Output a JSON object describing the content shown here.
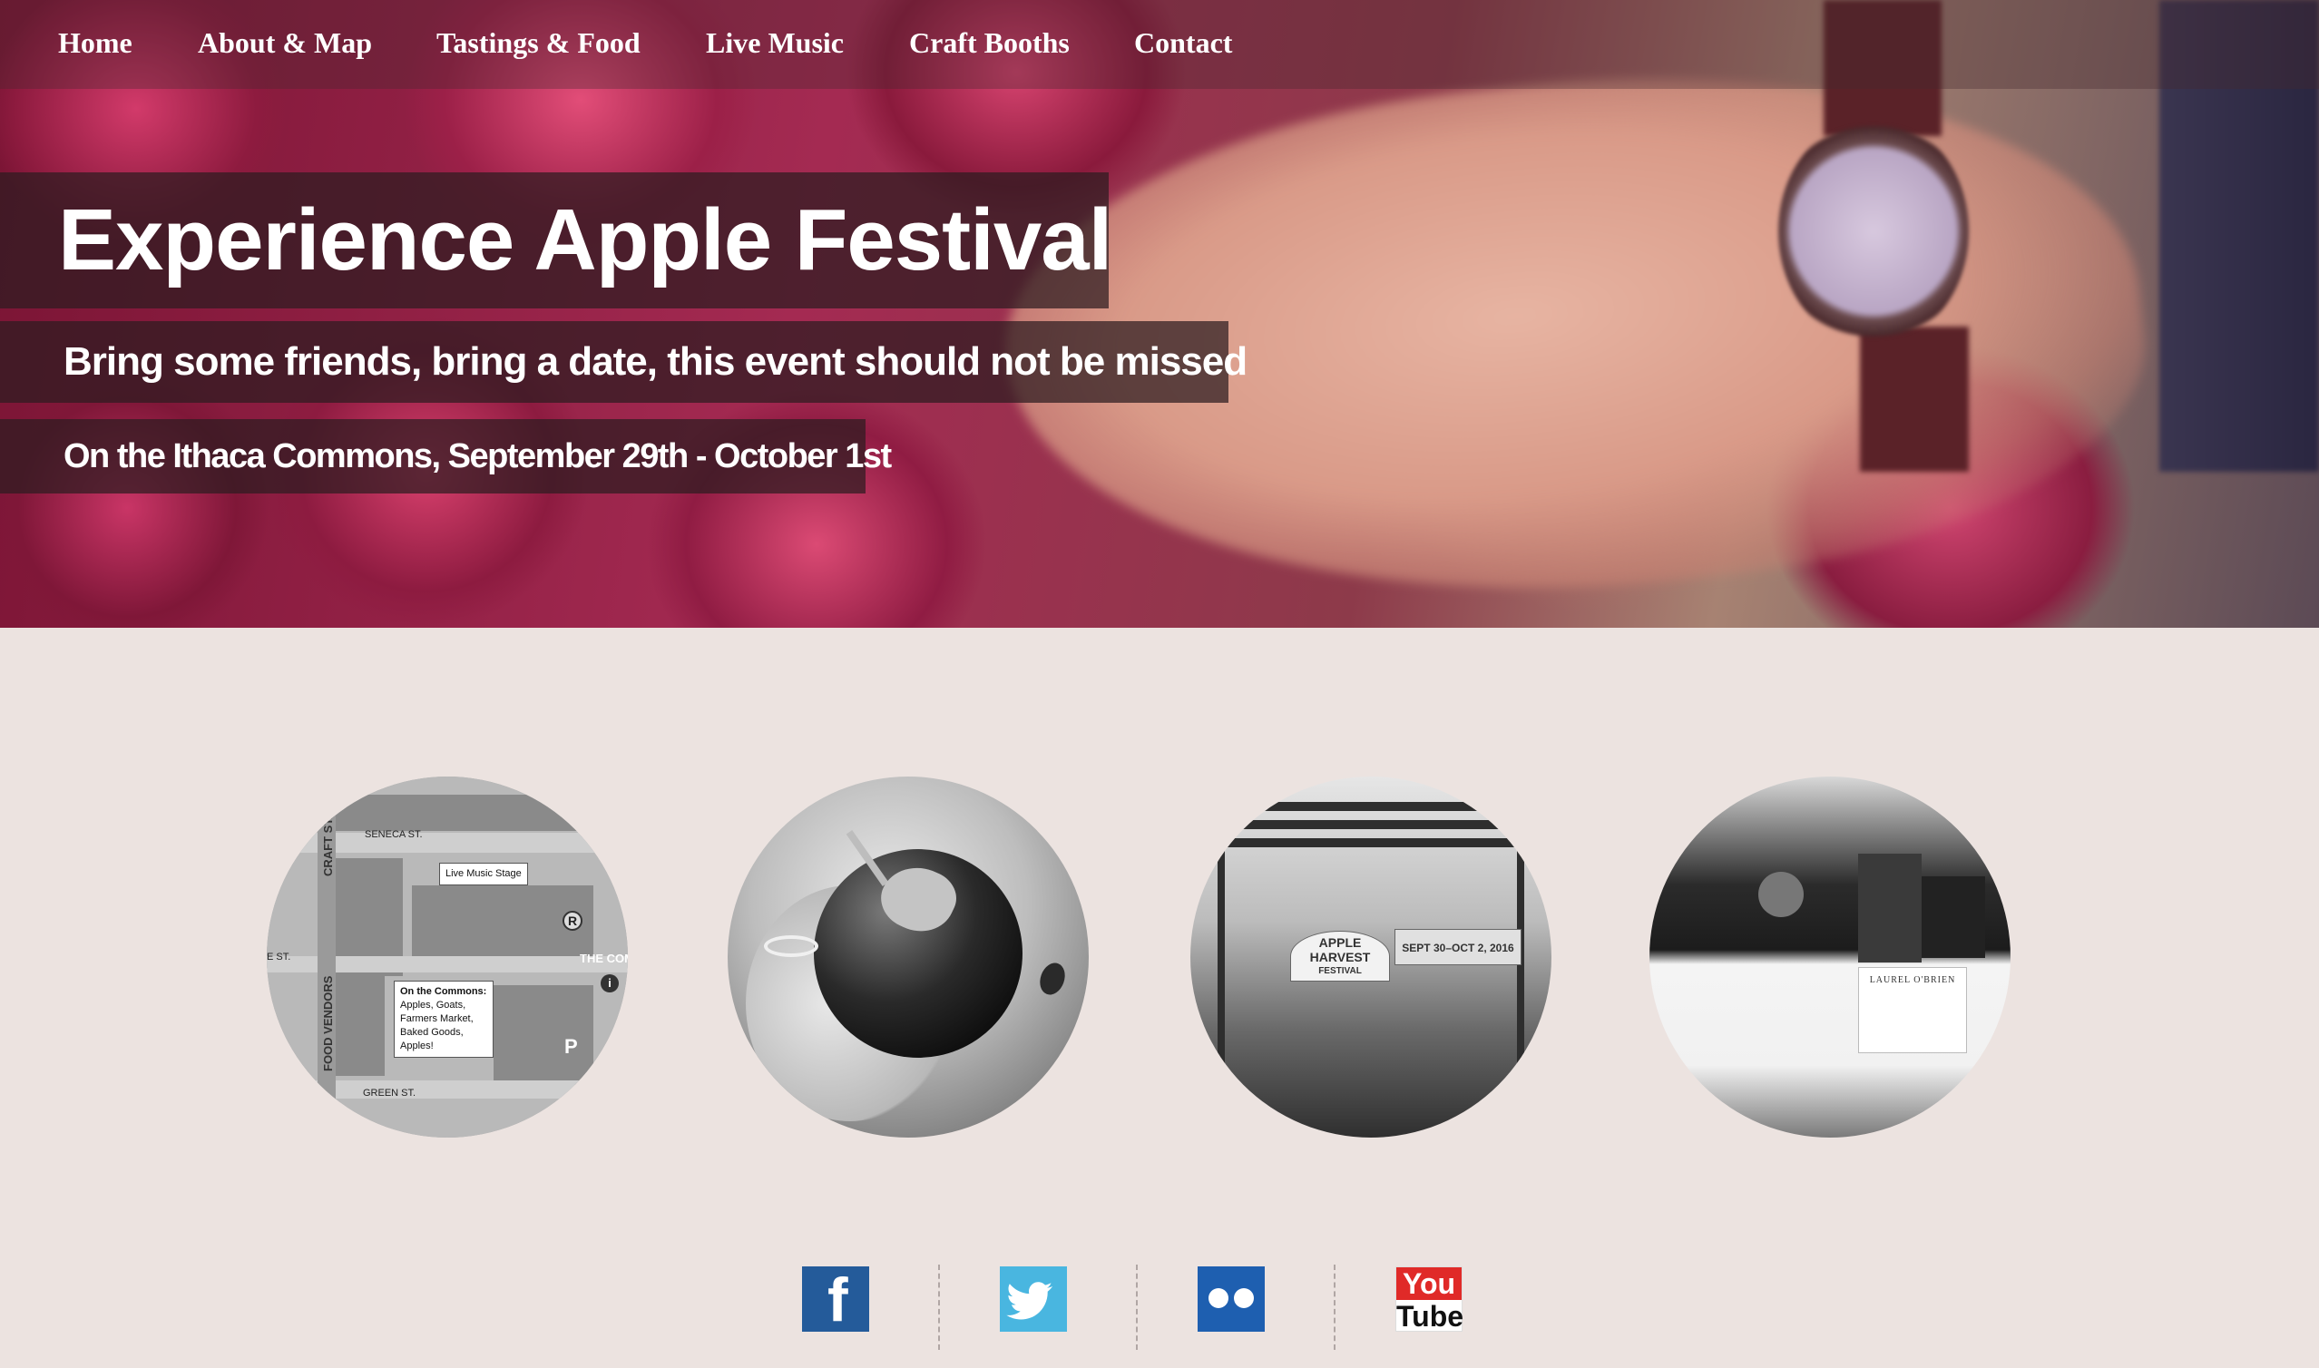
{
  "nav": {
    "items": [
      {
        "label": "Home"
      },
      {
        "label": "About & Map"
      },
      {
        "label": "Tastings & Food"
      },
      {
        "label": "Live Music"
      },
      {
        "label": "Craft Booths"
      },
      {
        "label": "Contact"
      }
    ]
  },
  "hero": {
    "title": "Experience Apple Festival",
    "subtitle": "Bring some friends, bring a date, this event should not be missed",
    "date_line": "On the Ithaca Commons, September 29th - October 1st"
  },
  "features": {
    "map": {
      "street_seneca": "SENECA ST.",
      "street_green": "GREEN ST.",
      "street_craft": "CRAFT ST.",
      "street_food_vendors": "FOOD VENDORS",
      "street_e": "E ST.",
      "the_com": "THE COM",
      "live_music_stage": "Live Music Stage",
      "commons_title": "On the Commons:",
      "commons_items": [
        "Apples, Goats,",
        "Farmers Market,",
        "Baked Goods,",
        "Apples!"
      ],
      "parking": "P",
      "rest": "R",
      "info": "i"
    },
    "stage": {
      "banner_left": "APPLE HARVEST",
      "banner_left_sub": "FESTIVAL",
      "banner_right": "SEPT 30–OCT 2, 2016"
    },
    "booth": {
      "sign": "LAUREL O'BRIEN"
    }
  },
  "social": {
    "facebook": "f",
    "youtube_top": "You",
    "youtube_bottom": "Tube",
    "icons": [
      "facebook-icon",
      "twitter-icon",
      "flickr-icon",
      "youtube-icon"
    ]
  },
  "colors": {
    "page_bg": "#ece3e0",
    "band_bg": "rgba(45,28,32,0.72)",
    "facebook": "#245b9a",
    "twitter": "#49b6e0",
    "flickr": "#1e5fb0",
    "youtube_red": "#e02a28"
  }
}
